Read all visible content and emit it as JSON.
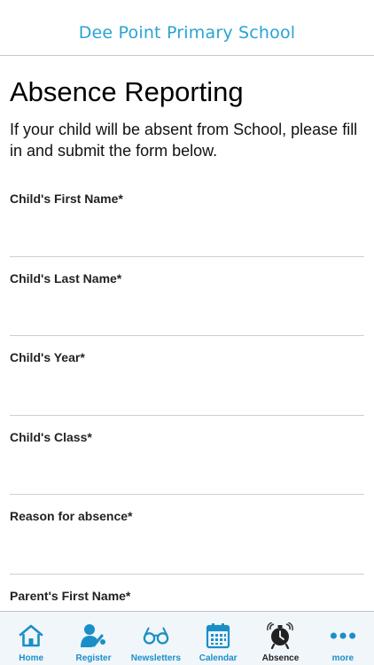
{
  "header": {
    "school_name": "Dee Point Primary School"
  },
  "page": {
    "title": "Absence Reporting",
    "intro": "If your child will be absent from School, please fill in and submit the form below."
  },
  "form": {
    "fields": [
      {
        "label": "Child's First Name*",
        "value": ""
      },
      {
        "label": "Child's Last Name*",
        "value": ""
      },
      {
        "label": "Child's Year*",
        "value": ""
      },
      {
        "label": "Child's Class*",
        "value": ""
      },
      {
        "label": "Reason for absence*",
        "value": ""
      },
      {
        "label": "Parent's First Name*",
        "value": ""
      }
    ]
  },
  "tabbar": {
    "tabs": [
      {
        "label": "Home",
        "icon": "home-icon"
      },
      {
        "label": "Register",
        "icon": "register-icon"
      },
      {
        "label": "Newsletters",
        "icon": "glasses-icon"
      },
      {
        "label": "Calendar",
        "icon": "calendar-icon"
      },
      {
        "label": "Absence",
        "icon": "alarm-clock-icon",
        "active": true
      },
      {
        "label": "more",
        "icon": "more-dots-icon"
      }
    ]
  },
  "colors": {
    "accent": "#1a8fc7",
    "brand": "#2aa3d6",
    "tabbar_bg": "#f1f6fb"
  }
}
